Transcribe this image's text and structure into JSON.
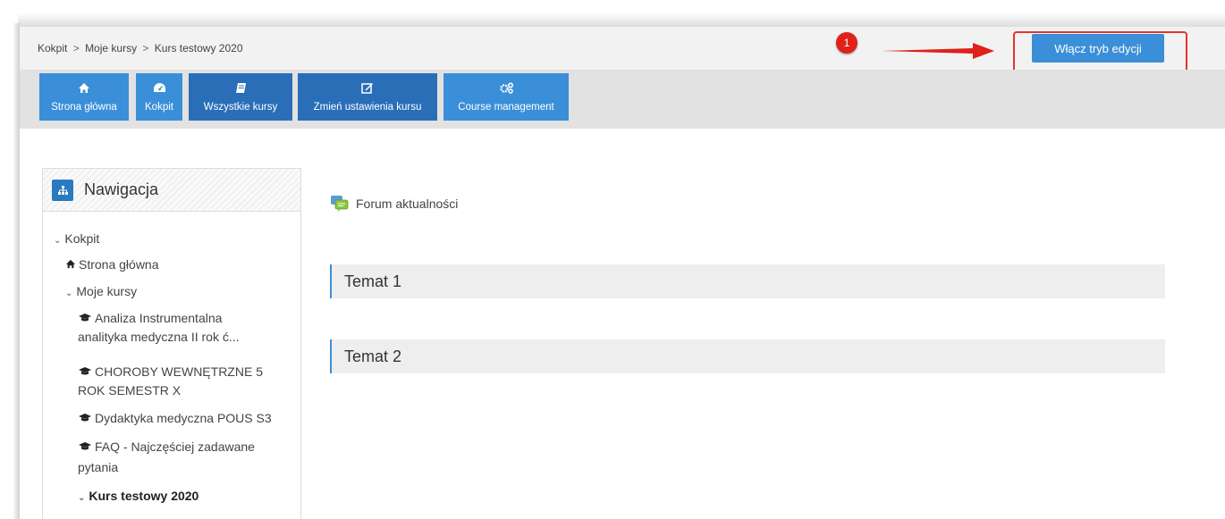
{
  "breadcrumb": {
    "item1": "Kokpit",
    "item2": "Moje kursy",
    "item3": "Kurs testowy 2020",
    "sep": ">"
  },
  "edit_button": {
    "label": "Włącz tryb edycji"
  },
  "annotation": {
    "badge": "1"
  },
  "nav": [
    {
      "label": "Strona główna",
      "icon": "home-icon"
    },
    {
      "label": "Kokpit",
      "icon": "dashboard-icon"
    },
    {
      "label": "Wszystkie kursy",
      "icon": "book-icon"
    },
    {
      "label": "Zmień ustawienia kursu",
      "icon": "edit-icon"
    },
    {
      "label": "Course management",
      "icon": "cogs-icon"
    }
  ],
  "sidebar": {
    "title": "Nawigacja",
    "items": [
      {
        "label": "Kokpit"
      },
      {
        "label": "Strona główna"
      },
      {
        "label": "Moje kursy"
      },
      {
        "line1": "Analiza Instrumentalna",
        "line2": "analityka medyczna II rok ć..."
      },
      {
        "line1": "CHOROBY WEWNĘTRZNE 5",
        "line2": "ROK SEMESTR X"
      },
      {
        "label": "Dydaktyka medyczna POUS S3"
      },
      {
        "line1": "FAQ - Najczęściej zadawane",
        "line2": "pytania"
      },
      {
        "label": "Kurs testowy 2020"
      }
    ]
  },
  "main": {
    "forum_label": "Forum aktualności",
    "topics": [
      {
        "label": "Temat 1"
      },
      {
        "label": "Temat 2"
      }
    ]
  },
  "colors": {
    "accent": "#3a8fd8",
    "accent_dark": "#2a6eb8",
    "annotation": "#e0201b"
  }
}
